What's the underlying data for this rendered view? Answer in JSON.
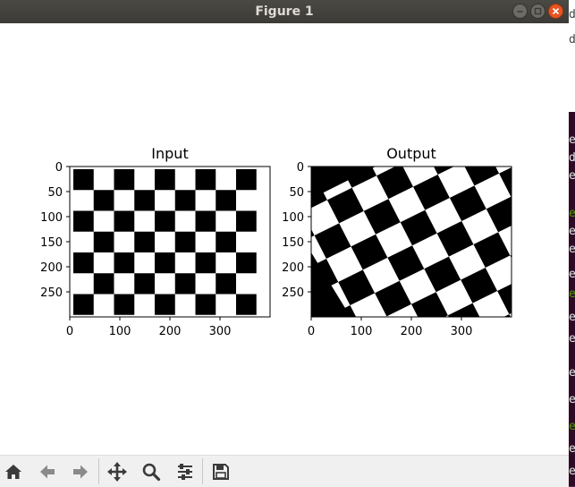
{
  "window": {
    "title": "Figure 1"
  },
  "axes": [
    {
      "title": "Input",
      "xticks": [
        "0",
        "100",
        "200",
        "300"
      ],
      "yticks": [
        "0",
        "50",
        "100",
        "150",
        "200",
        "250"
      ]
    },
    {
      "title": "Output",
      "xticks": [
        "0",
        "100",
        "200",
        "300"
      ],
      "yticks": [
        "0",
        "50",
        "100",
        "150",
        "200",
        "250"
      ]
    }
  ],
  "toolbar": {
    "buttons": [
      "home-icon",
      "back-arrow-icon",
      "forward-arrow-icon",
      "pan-icon",
      "zoom-icon",
      "configure-subplots-icon",
      "save-icon"
    ]
  },
  "background_terminal": [
    "d",
    "d",
    "e",
    "d",
    "e",
    "e",
    "e",
    "e",
    "e",
    "e",
    "e",
    "e",
    "e",
    "e",
    "e",
    "e",
    "e"
  ],
  "colors": {
    "title_bar": "#3c3b37",
    "close_button": "#e95420",
    "board_dark": "#000000",
    "board_light": "#ffffff"
  }
}
